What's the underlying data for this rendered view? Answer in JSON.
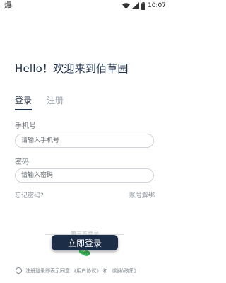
{
  "status_bar": {
    "app_icon": "爆",
    "time": "10:07",
    "icons": [
      "wifi-icon",
      "signal-icon",
      "battery-icon"
    ]
  },
  "greeting": "Hello！欢迎来到佰草园",
  "tabs": {
    "login": "登录",
    "register": "注册"
  },
  "phone": {
    "label": "手机号",
    "placeholder": "请输入手机号",
    "value": ""
  },
  "password": {
    "label": "密码",
    "placeholder": "请输入密码",
    "value": ""
  },
  "links": {
    "forgot": "忘记密码?",
    "unfreeze": "账号解绑"
  },
  "third_party": {
    "label": "第三方登录",
    "icon": "wechat-icon"
  },
  "login_button": "立即登录",
  "agreement": {
    "prefix": "注册登录即表示同意",
    "user_agreement": "《用户协议》",
    "and": "和",
    "privacy_policy": "《隐私政策》"
  },
  "colors": {
    "primary": "#1c2d48",
    "wechat": "#35c759",
    "muted": "#8b9198"
  }
}
